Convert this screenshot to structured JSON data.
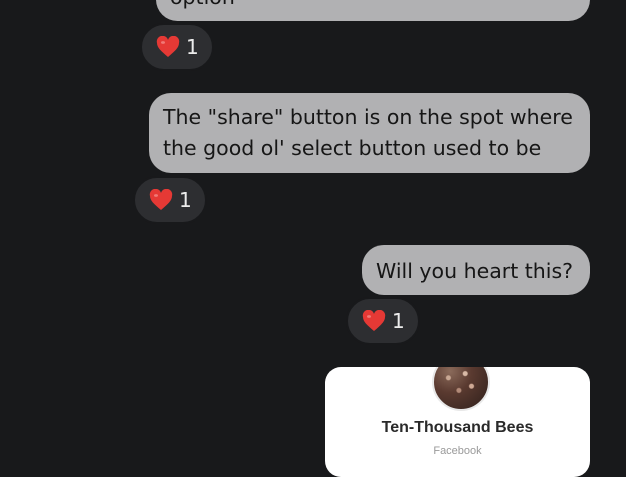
{
  "messages": [
    {
      "text": "option",
      "reaction": {
        "emoji": "heart-emoji",
        "count": "1"
      }
    },
    {
      "lines": [
        "The \"share\" button is on the spot where",
        "the good ol' select button used to be"
      ],
      "reaction": {
        "emoji": "heart-emoji",
        "count": "1"
      }
    },
    {
      "text": "Will you heart this?",
      "reaction": {
        "emoji": "heart-emoji",
        "count": "1"
      }
    }
  ],
  "shared_card": {
    "title": "Ten-Thousand Bees",
    "subtitle": "Facebook"
  },
  "colors": {
    "background": "#18191b",
    "bubble": "#b1b1b3",
    "reaction_pill": "#2d2e31",
    "heart": "#e53935"
  }
}
